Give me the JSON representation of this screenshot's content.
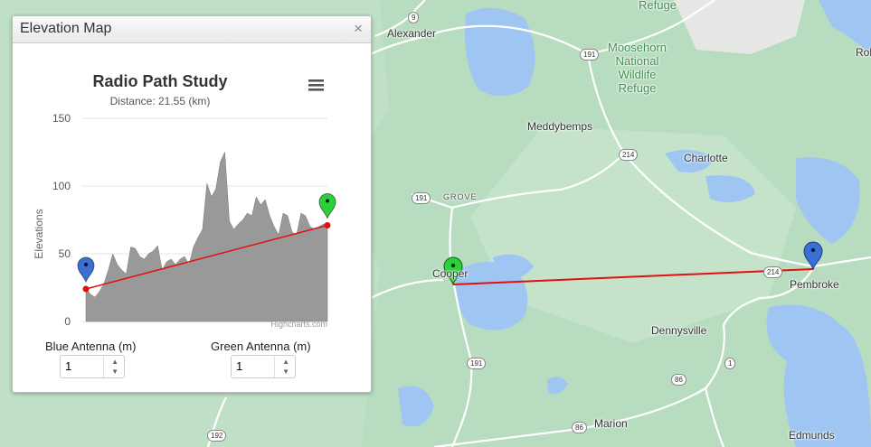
{
  "map": {
    "places": [
      {
        "name": "Alexander"
      },
      {
        "name": "Meddybemps"
      },
      {
        "name": "Charlotte"
      },
      {
        "name": "Pembroke"
      },
      {
        "name": "Dennysville"
      },
      {
        "name": "Marion"
      },
      {
        "name": "Edmunds"
      },
      {
        "name": "Cooper"
      },
      {
        "name": "GROVE"
      },
      {
        "name": "Refuge"
      },
      {
        "name": "Rol"
      }
    ],
    "refuge_label": "Moosehorn\nNational\nWildlife\nRefuge",
    "route_shields": [
      {
        "label": "9"
      },
      {
        "label": "191"
      },
      {
        "label": "214"
      },
      {
        "label": "191"
      },
      {
        "label": "214"
      },
      {
        "label": "191"
      },
      {
        "label": "1"
      },
      {
        "label": "86"
      },
      {
        "label": "86"
      },
      {
        "label": "192"
      }
    ],
    "path_color": "#e01010",
    "blue_marker_color": "#3b6fd6",
    "green_marker_color": "#2bd13a"
  },
  "panel": {
    "title": "Elevation Map",
    "close_symbol": "×",
    "menu_icon": "hamburger-menu-icon"
  },
  "chart_data": {
    "type": "area",
    "title": "Radio Path Study",
    "subtitle": "Distance: 21.55 (km)",
    "ylabel": "Elevations",
    "xlabel": "",
    "ylim": [
      0,
      150
    ],
    "yticks": [
      0,
      50,
      100,
      150
    ],
    "grid": true,
    "credit": "Highcharts.com",
    "series": [
      {
        "name": "Elevation",
        "type": "area",
        "color": "#999999",
        "x": [
          0,
          0.4,
          0.8,
          1.2,
          1.6,
          2.0,
          2.4,
          2.8,
          3.2,
          3.6,
          4.0,
          4.4,
          4.8,
          5.2,
          5.6,
          6.0,
          6.4,
          6.8,
          7.2,
          7.6,
          8.0,
          8.4,
          8.8,
          9.2,
          9.6,
          10.0,
          10.4,
          10.8,
          11.2,
          11.6,
          12.0,
          12.4,
          12.8,
          13.2,
          13.6,
          14.0,
          14.4,
          14.8,
          15.2,
          15.6,
          16.0,
          16.4,
          16.8,
          17.2,
          17.6,
          18.0,
          18.4,
          18.8,
          19.2,
          19.6,
          20.0,
          20.4,
          20.8,
          21.2,
          21.55
        ],
        "y": [
          25,
          20,
          18,
          22,
          28,
          38,
          50,
          42,
          38,
          35,
          55,
          54,
          48,
          46,
          50,
          52,
          56,
          38,
          44,
          46,
          42,
          46,
          48,
          42,
          55,
          62,
          68,
          102,
          92,
          98,
          118,
          125,
          74,
          68,
          72,
          75,
          80,
          78,
          92,
          86,
          90,
          78,
          70,
          64,
          80,
          78,
          66,
          64,
          80,
          78,
          70,
          68,
          70,
          72,
          72
        ]
      },
      {
        "name": "Path",
        "type": "line",
        "color": "#e01010",
        "x": [
          0,
          21.55
        ],
        "y": [
          24,
          71
        ]
      }
    ],
    "markers": [
      {
        "name": "Blue Antenna",
        "x": 0,
        "y": 24,
        "color": "#3b6fd6"
      },
      {
        "name": "Green Antenna",
        "x": 21.55,
        "y": 71,
        "color": "#2bd13a"
      }
    ]
  },
  "controls": {
    "blue_label": "Blue Antenna (m)",
    "blue_value": "1",
    "green_label": "Green Antenna (m)",
    "green_value": "1",
    "up_arrow": "▲",
    "down_arrow": "▼"
  }
}
